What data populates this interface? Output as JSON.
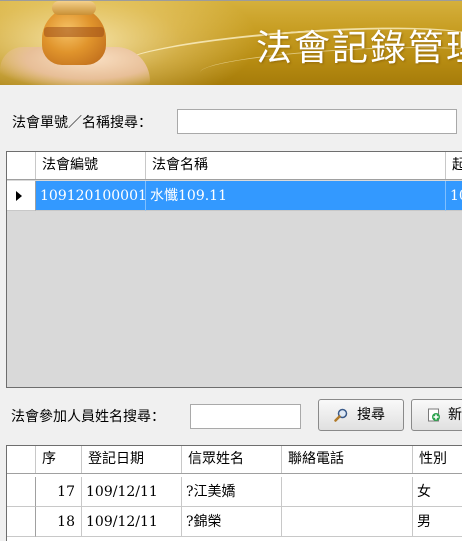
{
  "banner": {
    "title": "法會記錄管理"
  },
  "search_event": {
    "label": "法會單號／名稱搜尋：",
    "value": ""
  },
  "events_grid": {
    "columns": [
      "",
      "法會編號",
      "法會名稱",
      "起"
    ],
    "rows": [
      {
        "id": "109120100001",
        "name": "水懺109.11",
        "start": "10"
      }
    ]
  },
  "search_participant": {
    "label": "法會參加人員姓名搜尋：",
    "value": "",
    "search_button": "搜尋",
    "new_button": "新"
  },
  "participants_grid": {
    "columns": [
      "序",
      "登記日期",
      "信眾姓名",
      "聯絡電話",
      "性別"
    ],
    "rows": [
      {
        "seq": "17",
        "date": "109/12/11",
        "name": "?江美嬌",
        "phone": "",
        "gender": "女"
      },
      {
        "seq": "18",
        "date": "109/12/11",
        "name": "?錦榮",
        "phone": "",
        "gender": "男"
      }
    ]
  },
  "colors": {
    "selection": "#3399ff",
    "banner": "#c79d22"
  }
}
